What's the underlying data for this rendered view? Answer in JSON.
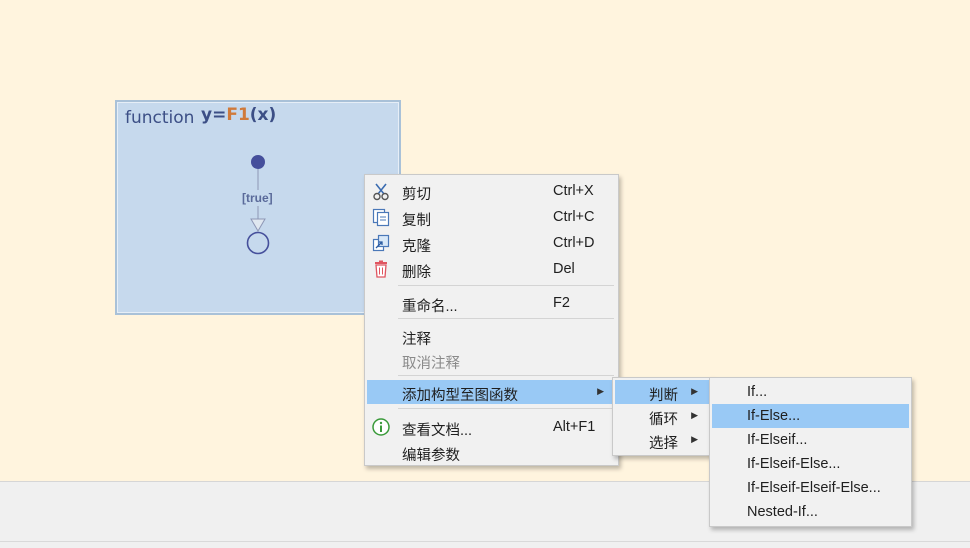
{
  "canvas": {
    "function_block": {
      "keyword": "function",
      "signature_prefix": "y=",
      "function_name": "F1",
      "signature_suffix": "(x)",
      "transition_label": "[true]"
    }
  },
  "context_menu": {
    "items": [
      {
        "label": "剪切",
        "shortcut": "Ctrl+X",
        "icon": "scissors-icon"
      },
      {
        "label": "复制",
        "shortcut": "Ctrl+C",
        "icon": "copy-icon"
      },
      {
        "label": "克隆",
        "shortcut": "Ctrl+D",
        "icon": "clone-icon"
      },
      {
        "label": "删除",
        "shortcut": "Del",
        "icon": "trash-icon"
      },
      {
        "label": "重命名...",
        "shortcut": "F2"
      },
      {
        "label": "注释"
      },
      {
        "label": "取消注释",
        "disabled": true
      },
      {
        "label": "添加构型至图函数",
        "submenu": true,
        "active": true
      },
      {
        "label": "查看文档...",
        "shortcut": "Alt+F1",
        "icon": "info-icon"
      },
      {
        "label": "编辑参数"
      }
    ]
  },
  "construct_submenu": {
    "items": [
      {
        "label": "判断",
        "active": true
      },
      {
        "label": "循环"
      },
      {
        "label": "选择"
      }
    ]
  },
  "decision_submenu": {
    "items": [
      {
        "label": "If..."
      },
      {
        "label": "If-Else...",
        "active": true
      },
      {
        "label": "If-Elseif..."
      },
      {
        "label": "If-Elseif-Else..."
      },
      {
        "label": "If-Elseif-Elseif-Else..."
      },
      {
        "label": "Nested-If..."
      }
    ]
  },
  "colors": {
    "canvas_bg": "#fff4de",
    "function_bg": "#c6d9ed",
    "highlight": "#99c9f5",
    "menu_bg": "#f1f1f1"
  }
}
